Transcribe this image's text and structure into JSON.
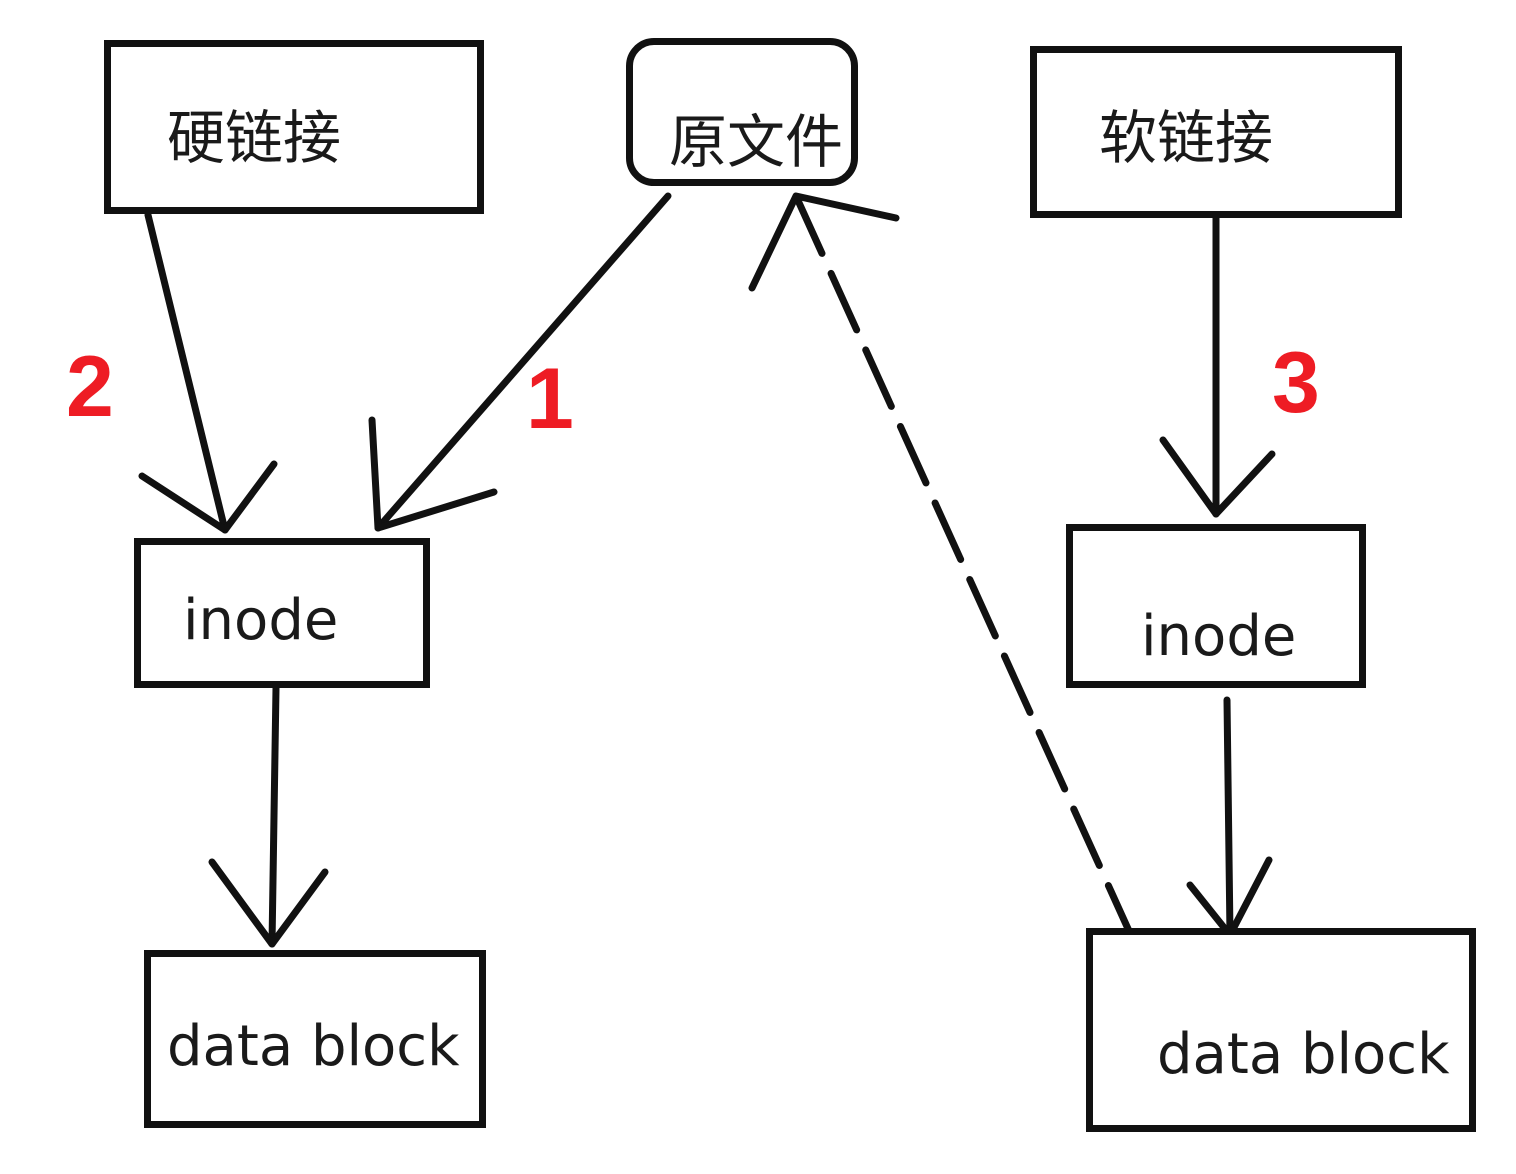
{
  "nodes": {
    "hard_link": "硬链接",
    "original_file": "原文件",
    "soft_link": "软链接",
    "inode_left": "inode",
    "inode_right": "inode",
    "data_block_left": "data block",
    "data_block_right": "data block"
  },
  "edge_labels": {
    "one": "1",
    "two": "2",
    "three": "3"
  },
  "colors": {
    "stroke": "#111111",
    "label_accent": "#ee1c24"
  }
}
